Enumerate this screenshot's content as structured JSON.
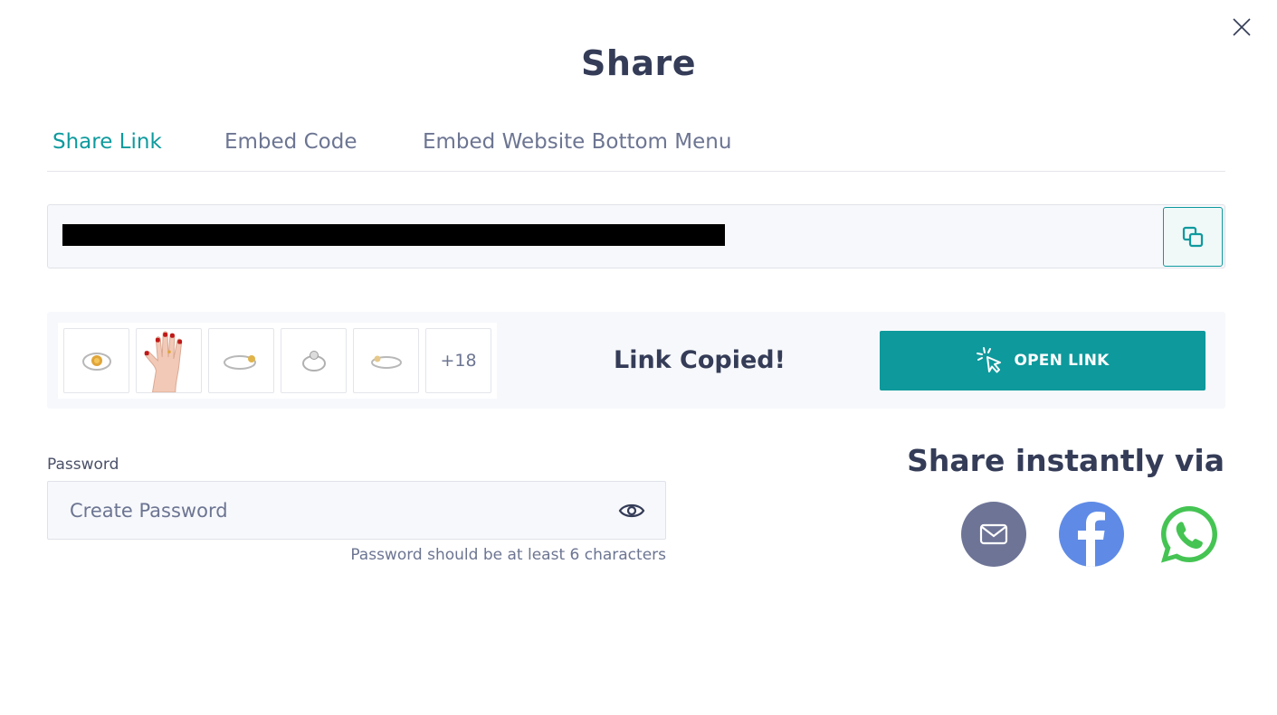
{
  "dialog": {
    "title": "Share",
    "close_icon": "close-icon"
  },
  "tabs": [
    {
      "label": "Share Link",
      "active": true
    },
    {
      "label": "Embed Code",
      "active": false
    },
    {
      "label": "Embed Website Bottom Menu",
      "active": false
    }
  ],
  "share_link": {
    "url": "",
    "url_redacted": true,
    "copy_icon": "copy-icon"
  },
  "media": {
    "thumbnails": [
      {
        "icon": "ring-image"
      },
      {
        "icon": "hand-image"
      },
      {
        "icon": "ring-image"
      },
      {
        "icon": "ring-image"
      },
      {
        "icon": "ring-image"
      }
    ],
    "more_count": "+18",
    "status": "Link Copied!",
    "open_link_label": "OPEN LINK",
    "open_link_icon": "cursor-click-icon"
  },
  "password": {
    "label": "Password",
    "placeholder": "Create Password",
    "value": "",
    "hint": "Password should be at least 6 characters",
    "toggle_icon": "eye-icon"
  },
  "share_via": {
    "heading": "Share instantly via",
    "channels": [
      {
        "name": "email",
        "icon": "mail-icon",
        "color": "#6d7496"
      },
      {
        "name": "facebook",
        "icon": "facebook-icon",
        "color": "#5f8be6"
      },
      {
        "name": "whatsapp",
        "icon": "whatsapp-icon",
        "color": "#45c453"
      }
    ]
  },
  "colors": {
    "accent": "#0e9a9e",
    "text_dark": "#343c57",
    "text_muted": "#6c7592",
    "panel_bg": "#f7f8fb"
  }
}
